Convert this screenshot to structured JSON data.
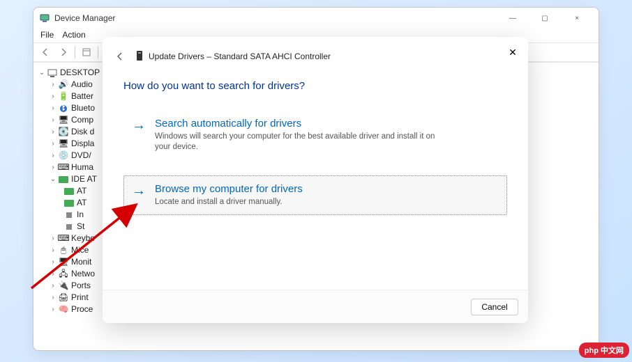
{
  "dm": {
    "title": "Device Manager",
    "menu": {
      "file": "File",
      "action": "Action"
    },
    "root": "DESKTOP",
    "nodes": [
      {
        "label": "Audio",
        "icon": "speaker"
      },
      {
        "label": "Batter",
        "icon": "battery"
      },
      {
        "label": "Blueto",
        "icon": "bluetooth"
      },
      {
        "label": "Comp",
        "icon": "monitor"
      },
      {
        "label": "Disk d",
        "icon": "disk"
      },
      {
        "label": "Displa",
        "icon": "display"
      },
      {
        "label": "DVD/",
        "icon": "dvd"
      },
      {
        "label": "Huma",
        "icon": "hid"
      }
    ],
    "ide": "IDE AT",
    "ide_children": [
      {
        "label": "AT",
        "icon": "card"
      },
      {
        "label": "AT",
        "icon": "card"
      },
      {
        "label": "In",
        "icon": "chip"
      },
      {
        "label": "St",
        "icon": "chip"
      }
    ],
    "after": [
      {
        "label": "Keybo",
        "icon": "keyboard"
      },
      {
        "label": "Mice",
        "icon": "mouse"
      },
      {
        "label": "Monit",
        "icon": "monitor"
      },
      {
        "label": "Netwo",
        "icon": "network"
      },
      {
        "label": "Ports",
        "icon": "port"
      },
      {
        "label": "Print",
        "icon": "printer"
      },
      {
        "label": "Proce",
        "icon": "cpu"
      }
    ],
    "sys": {
      "min": "—",
      "max": "▢",
      "close": "×"
    }
  },
  "dialog": {
    "title": "Update Drivers – Standard SATA AHCI Controller",
    "question": "How do you want to search for drivers?",
    "opt1": {
      "title": "Search automatically for drivers",
      "sub": "Windows will search your computer for the best available driver and install it on your device."
    },
    "opt2": {
      "title": "Browse my computer for drivers",
      "sub": "Locate and install a driver manually."
    },
    "cancel": "Cancel"
  },
  "badge": "php 中文网"
}
